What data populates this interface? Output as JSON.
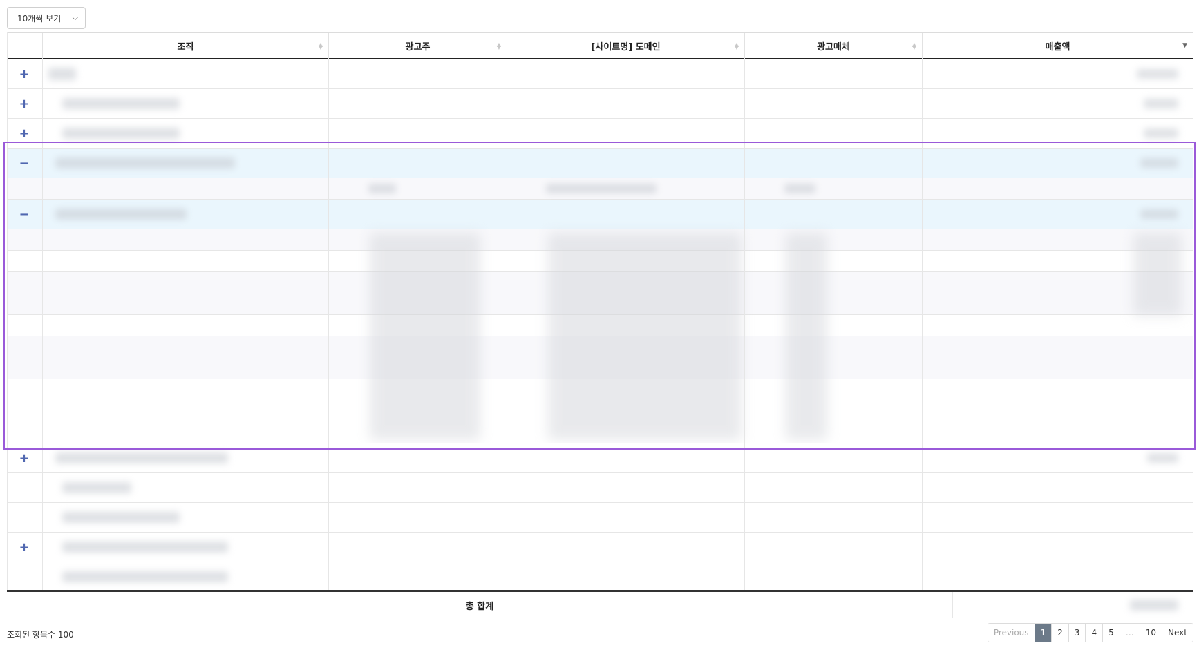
{
  "length_select": {
    "label": "10개씩 보기"
  },
  "table": {
    "columns": [
      "조직",
      "광고주",
      "[사이트명] 도메인",
      "광고매체",
      "매출액"
    ],
    "footer_label": "총 합계"
  },
  "info": {
    "text": "조회된 항목수 100"
  },
  "pagination": {
    "previous": "Previous",
    "pages": [
      "1",
      "2",
      "3",
      "4",
      "5",
      "…",
      "10"
    ],
    "next": "Next",
    "active": "1"
  },
  "icons": {
    "expand": "plus-icon",
    "collapse": "minus-icon",
    "select_chevron": "chevron-down-icon"
  },
  "colors": {
    "highlight": "#9a5ad9",
    "expanded_row": "#eaf6fd",
    "active_page": "#6c7a89",
    "toggle": "#5067b0"
  }
}
